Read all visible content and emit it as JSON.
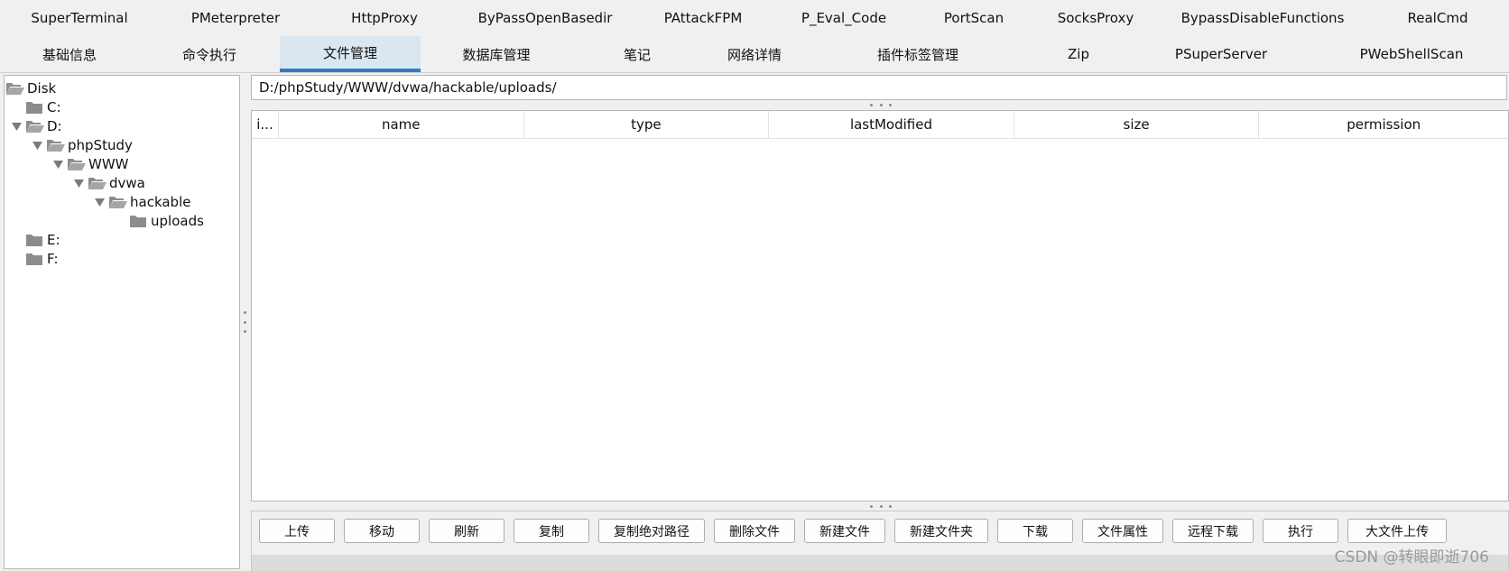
{
  "tabs_row1": [
    {
      "label": "SuperTerminal"
    },
    {
      "label": "PMeterpreter"
    },
    {
      "label": "HttpProxy"
    },
    {
      "label": "ByPassOpenBasedir"
    },
    {
      "label": "PAttackFPM"
    },
    {
      "label": "P_Eval_Code"
    },
    {
      "label": "PortScan"
    },
    {
      "label": "SocksProxy"
    },
    {
      "label": "BypassDisableFunctions"
    },
    {
      "label": "RealCmd"
    }
  ],
  "tabs_row2": [
    {
      "label": "基础信息"
    },
    {
      "label": "命令执行"
    },
    {
      "label": "文件管理",
      "active": true
    },
    {
      "label": "数据库管理"
    },
    {
      "label": "笔记"
    },
    {
      "label": "网络详情"
    },
    {
      "label": "插件标签管理"
    },
    {
      "label": "Zip"
    },
    {
      "label": "PSuperServer"
    },
    {
      "label": "PWebShellScan"
    }
  ],
  "tree": [
    {
      "label": "Disk",
      "level": 0,
      "expanded": true,
      "has_arrow": false
    },
    {
      "label": "C:",
      "level": 1,
      "expanded": false,
      "has_arrow": false
    },
    {
      "label": "D:",
      "level": 1,
      "expanded": true,
      "has_arrow": true
    },
    {
      "label": "phpStudy",
      "level": 2,
      "expanded": true,
      "has_arrow": true
    },
    {
      "label": "WWW",
      "level": 3,
      "expanded": true,
      "has_arrow": true
    },
    {
      "label": "dvwa",
      "level": 4,
      "expanded": true,
      "has_arrow": true
    },
    {
      "label": "hackable",
      "level": 5,
      "expanded": true,
      "has_arrow": true
    },
    {
      "label": "uploads",
      "level": 6,
      "expanded": false,
      "has_arrow": false
    },
    {
      "label": "E:",
      "level": 1,
      "expanded": false,
      "has_arrow": false
    },
    {
      "label": "F:",
      "level": 1,
      "expanded": false,
      "has_arrow": false
    }
  ],
  "path": {
    "value": "D:/phpStudy/WWW/dvwa/hackable/uploads/"
  },
  "table": {
    "columns": [
      "i...",
      "name",
      "type",
      "lastModified",
      "size",
      "permission"
    ],
    "rows": []
  },
  "buttons": [
    {
      "label": "上传"
    },
    {
      "label": "移动"
    },
    {
      "label": "刷新"
    },
    {
      "label": "复制"
    },
    {
      "label": "复制绝对路径"
    },
    {
      "label": "删除文件"
    },
    {
      "label": "新建文件"
    },
    {
      "label": "新建文件夹"
    },
    {
      "label": "下载"
    },
    {
      "label": "文件属性"
    },
    {
      "label": "远程下载"
    },
    {
      "label": "执行"
    },
    {
      "label": "大文件上传"
    }
  ],
  "watermark": "CSDN @转眼即逝706",
  "colors": {
    "active_tab_bg": "#dae6f0",
    "active_tab_underline": "#2f7dc2",
    "folder": "#8c8c8c"
  }
}
